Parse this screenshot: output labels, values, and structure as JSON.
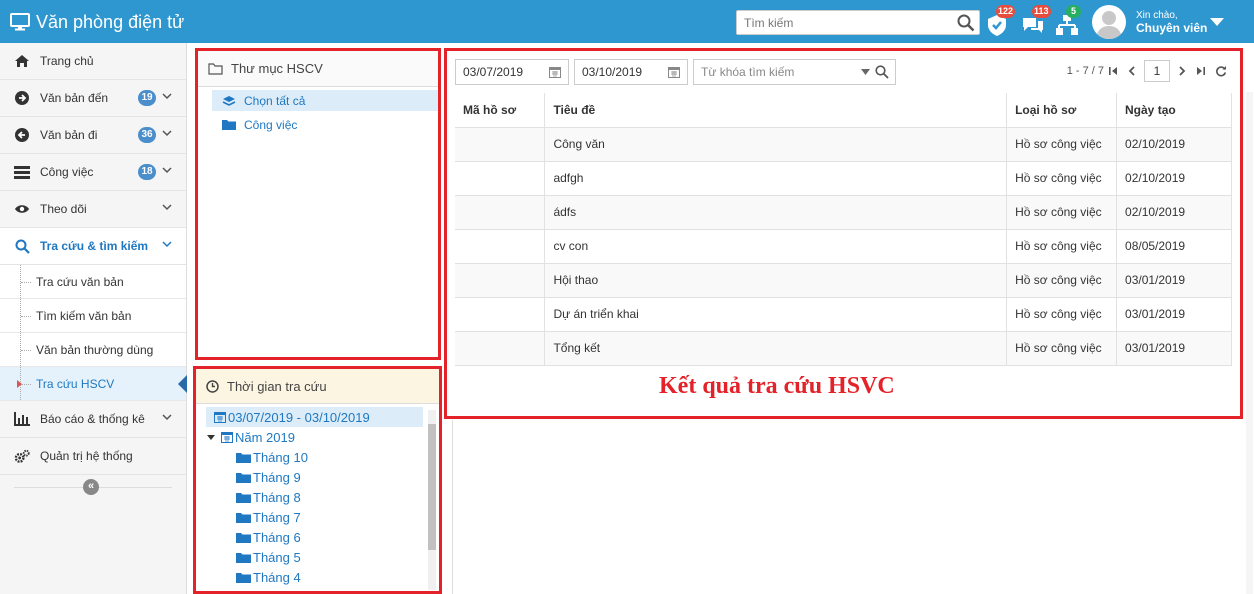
{
  "app": {
    "title": "Văn phòng điện tử"
  },
  "header": {
    "search_placeholder": "Tìm kiếm",
    "notifications": [
      {
        "icon": "shield-check-icon",
        "count": "122",
        "color": "#e74c3c"
      },
      {
        "icon": "chat-icon",
        "count": "113",
        "color": "#e74c3c"
      },
      {
        "icon": "sitemap-icon",
        "count": "5",
        "color": "#27ae60"
      }
    ],
    "greeting": "Xin chào,",
    "user_name": "Chuyên viên"
  },
  "sidebar": {
    "items": [
      {
        "label": "Trang chủ",
        "icon": "home-icon"
      },
      {
        "label": "Văn bản đến",
        "icon": "arrow-right-circle-icon",
        "count": "19"
      },
      {
        "label": "Văn bản đi",
        "icon": "arrow-left-circle-icon",
        "count": "36"
      },
      {
        "label": "Công việc",
        "icon": "tasks-icon",
        "count": "18"
      },
      {
        "label": "Theo dõi",
        "icon": "eye-icon"
      },
      {
        "label": "Tra cứu & tìm kiếm",
        "icon": "search-icon"
      }
    ],
    "sub_items": [
      {
        "label": "Tra cứu văn bản"
      },
      {
        "label": "Tìm kiếm văn bản"
      },
      {
        "label": "Văn bản thường dùng"
      },
      {
        "label": "Tra cứu HSCV"
      }
    ],
    "bottom_items": [
      {
        "label": "Báo cáo & thống kê",
        "icon": "bar-chart-icon"
      },
      {
        "label": "Quản trị hệ thống",
        "icon": "cogs-icon"
      }
    ],
    "collapse_label": "«"
  },
  "folder_panel": {
    "title": "Thư mục HSCV",
    "items": [
      {
        "label": "Chọn tất cả",
        "icon": "layers-icon"
      },
      {
        "label": "Công việc",
        "icon": "folder-icon"
      }
    ]
  },
  "time_panel": {
    "title": "Thời gian tra cứu",
    "range": "03/07/2019 - 03/10/2019",
    "year": "Năm 2019",
    "months": [
      "Tháng 10",
      "Tháng 9",
      "Tháng 8",
      "Tháng 7",
      "Tháng 6",
      "Tháng 5",
      "Tháng 4"
    ]
  },
  "results": {
    "from_date": "03/07/2019",
    "to_date": "03/10/2019",
    "keyword_placeholder": "Từ khóa tìm kiếm",
    "pager_range": "1 - 7 / 7",
    "page": "1",
    "columns": [
      "Mã hồ sơ",
      "Tiêu đề",
      "Loại hồ sơ",
      "Ngày tạo"
    ],
    "rows": [
      [
        "",
        "Công văn",
        "Hồ sơ công việc",
        "02/10/2019"
      ],
      [
        "",
        "adfgh",
        "Hồ sơ công việc",
        "02/10/2019"
      ],
      [
        "",
        "ádfs",
        "Hồ sơ công việc",
        "02/10/2019"
      ],
      [
        "",
        "cv con",
        "Hồ sơ công việc",
        "08/05/2019"
      ],
      [
        "",
        "Hội thao",
        "Hồ sơ công việc",
        "03/01/2019"
      ],
      [
        "",
        "Dự án triển khai",
        "Hồ sơ công việc",
        "03/01/2019"
      ],
      [
        "",
        "Tổng kết",
        "Hồ sơ công việc",
        "03/01/2019"
      ]
    ],
    "caption": "Kết quả tra cứu HSVC"
  },
  "colors": {
    "header_bg": "#2f97d0",
    "highlight_border": "#e32329",
    "link": "#1f78c1"
  }
}
